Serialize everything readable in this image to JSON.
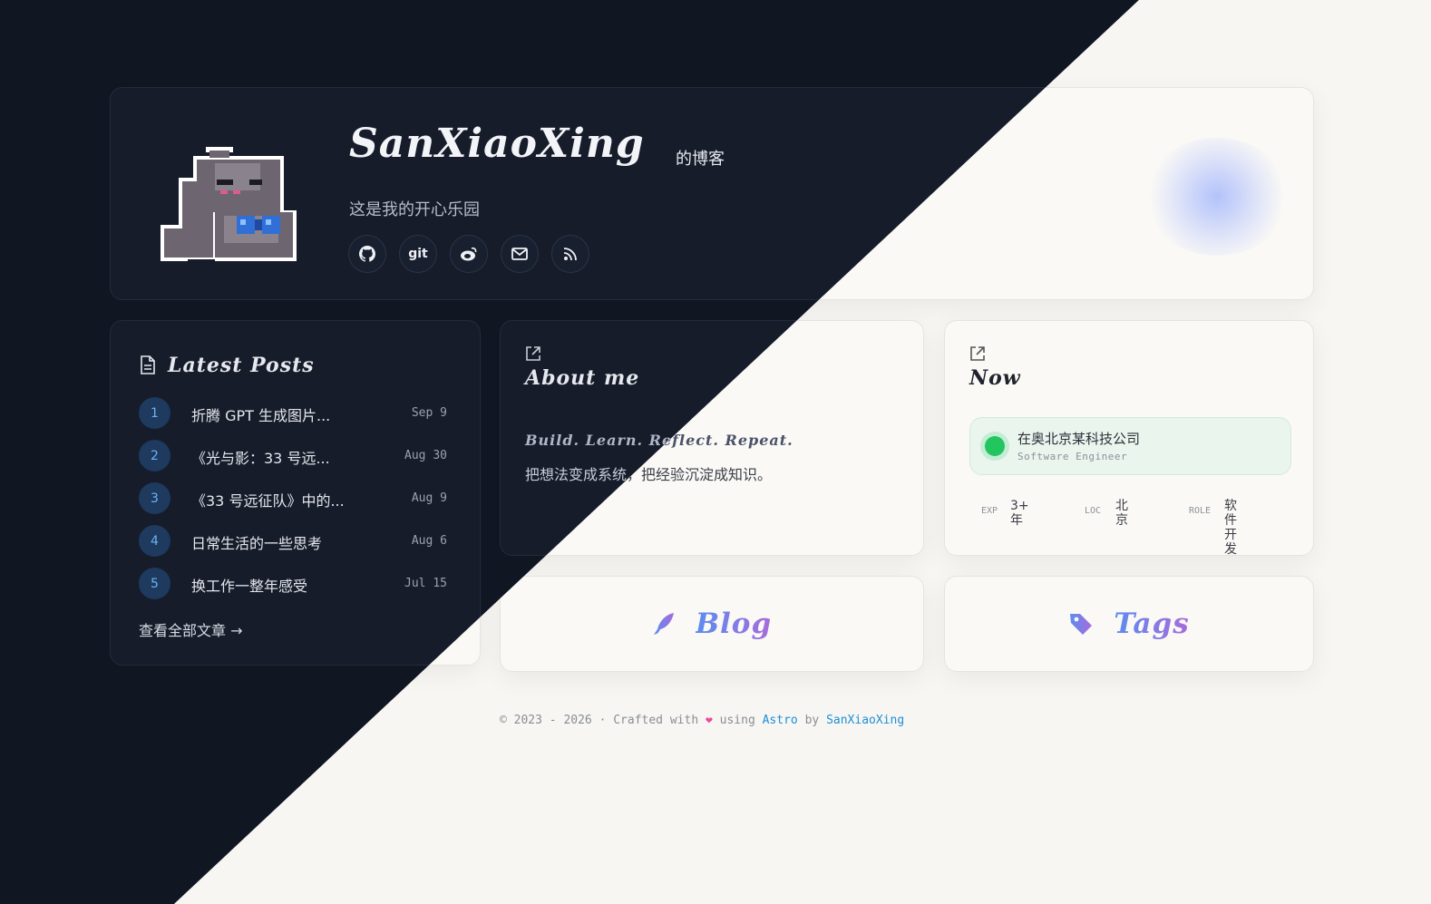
{
  "site": {
    "title": "SanXiaoXing",
    "title_suffix": "的博客",
    "subtitle": "这是我的开心乐园",
    "avatar": "pixel-dinosaur-avatar",
    "socials": [
      {
        "icon": "github-icon",
        "label": ""
      },
      {
        "icon": "git-icon",
        "label": "git"
      },
      {
        "icon": "weibo-icon",
        "label": ""
      },
      {
        "icon": "mail-icon",
        "label": ""
      },
      {
        "icon": "rss-icon",
        "label": ""
      }
    ]
  },
  "posts": {
    "title": "Latest Posts",
    "icon": "document-icon",
    "items": [
      {
        "num": "1",
        "title": "折腾 GPT 生成图片...",
        "date": "Sep 9"
      },
      {
        "num": "2",
        "title": "《光与影：33 号远...",
        "date": "Aug 30"
      },
      {
        "num": "3",
        "title": "《33 号远征队》中的...",
        "date": "Aug 9"
      },
      {
        "num": "4",
        "title": "日常生活的一些思考",
        "date": "Aug 6"
      },
      {
        "num": "5",
        "title": "换工作一整年感受",
        "date": "Jul 15"
      }
    ],
    "view_all": "查看全部文章 →"
  },
  "about": {
    "title": "About me",
    "motto": "Build. Learn. Reflect. Repeat.",
    "text": "把想法变成系统，把经验沉淀成知识。",
    "icon": "external-link-icon"
  },
  "now": {
    "title": "Now",
    "icon": "external-link-icon",
    "company": "在奥北京某科技公司",
    "role": "Software Engineer",
    "stats": [
      {
        "key": "EXP",
        "value": "3+\n年"
      },
      {
        "key": "LOC",
        "value": "北\n京"
      },
      {
        "key": "ROLE",
        "value": "软件开\n发"
      }
    ]
  },
  "nav": {
    "blog": {
      "label": "Blog",
      "icon": "quill-icon"
    },
    "tags": {
      "label": "Tags",
      "icon": "tag-icon"
    }
  },
  "footer": {
    "prefix": "© 2023 - 2026 · Crafted with",
    "heart": "❤",
    "using": "using",
    "framework": "Astro",
    "by": "by",
    "author": "SanXiaoXing"
  },
  "colors": {
    "dark_bg": "#111623",
    "light_bg": "#f7f6f2",
    "accent_blue": "#5b8def",
    "accent_purple": "#a86bdb",
    "status_green": "#22c55e",
    "link": "#1f8fd6"
  }
}
